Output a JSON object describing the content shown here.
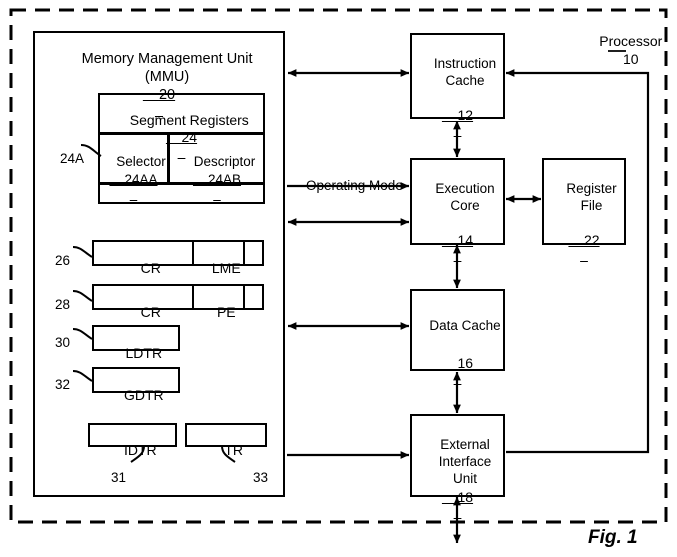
{
  "figure": {
    "caption": "Fig. 1",
    "outer_label_title": "Processor",
    "outer_label_ref": "10"
  },
  "mmu": {
    "title_line1": "Memory Management Unit",
    "title_line2": "(MMU)",
    "ref": "20"
  },
  "segment_registers": {
    "title": "Segment Registers",
    "ref": "24",
    "callout_ref": "24A",
    "selector": {
      "label": "Selector",
      "ref": "24AA"
    },
    "descriptor": {
      "label": "Descriptor",
      "ref": "24AB"
    }
  },
  "control_registers": [
    {
      "ref": "26",
      "name": "CR",
      "bit": "LME"
    },
    {
      "ref": "28",
      "name": "CR",
      "bit": "PE"
    }
  ],
  "table_registers": [
    {
      "ref": "30",
      "name": "LDTR"
    },
    {
      "ref": "32",
      "name": "GDTR"
    }
  ],
  "lower_registers": [
    {
      "ref": "31",
      "name": "IDTR"
    },
    {
      "ref": "33",
      "name": "TR"
    }
  ],
  "units": {
    "instruction_cache": {
      "line1": "Instruction",
      "line2": "Cache",
      "ref": "12"
    },
    "execution_core": {
      "line1": "Execution",
      "line2": "Core",
      "ref": "14"
    },
    "register_file": {
      "line1": "Register",
      "line2": "File",
      "ref": "22"
    },
    "data_cache": {
      "line1": "Data Cache",
      "line2": "",
      "ref": "16"
    },
    "external_interface_unit": {
      "line1": "External",
      "line2": "Interface",
      "line3": "Unit",
      "ref": "18"
    }
  },
  "signals": {
    "operating_mode": "Operating Mode"
  },
  "colors": {
    "ink": "#000000",
    "paper": "#ffffff"
  }
}
